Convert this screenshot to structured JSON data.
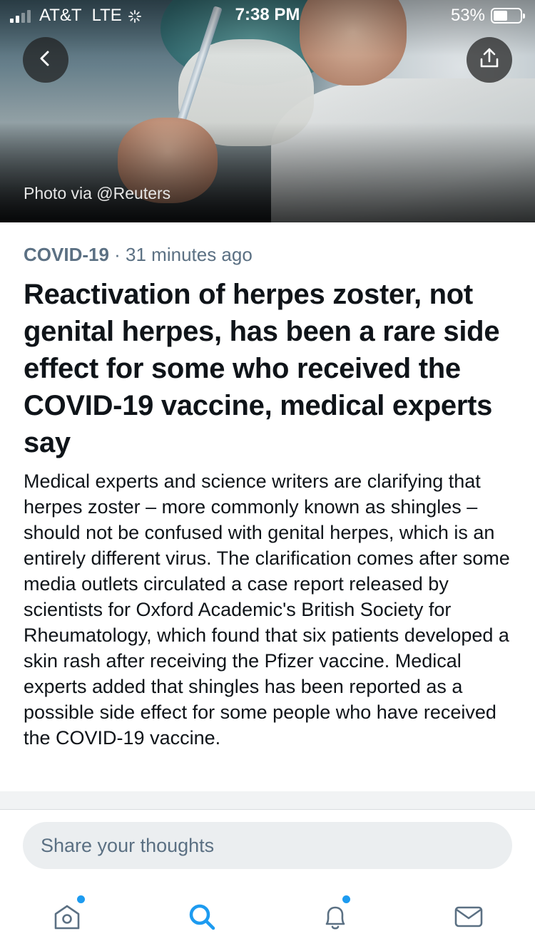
{
  "status_bar": {
    "carrier": "AT&T",
    "network": "LTE",
    "time": "7:38 PM",
    "battery_percent": "53%",
    "battery_level": 0.53
  },
  "hero": {
    "photo_credit": "Photo via @Reuters",
    "back_icon": "chevron-left-icon",
    "share_icon": "share-upload-icon"
  },
  "article": {
    "topic": "COVID-19",
    "separator": " · ",
    "time_ago": "31 minutes ago",
    "headline": "Reactivation of herpes zoster, not genital herpes, has been a rare side effect for some who received the COVID-19 vaccine, medical experts say",
    "body": "Medical experts and science writers are clarifying that herpes zoster – more commonly known as shingles – should not be confused with genital herpes, which is an entirely different virus. The clarification comes after some media outlets circulated a case report released by scientists for Oxford Academic's British Society for Rheumatology, which found that six patients developed a skin rash after receiving the Pfizer vaccine. Medical experts added that shingles has been reported as a possible side effect for some people who have received the COVID-19 vaccine."
  },
  "reply": {
    "placeholder": "Share your thoughts"
  },
  "tabbar": {
    "items": [
      {
        "name": "home",
        "icon": "home-icon",
        "has_dot": true
      },
      {
        "name": "search",
        "icon": "search-icon",
        "active": true
      },
      {
        "name": "notifications",
        "icon": "bell-icon",
        "has_dot": true
      },
      {
        "name": "messages",
        "icon": "mail-icon"
      }
    ]
  },
  "colors": {
    "accent": "#1d9bf0",
    "text_primary": "#0f1419",
    "text_secondary": "#5b7083",
    "input_bg": "#ebeef0"
  }
}
